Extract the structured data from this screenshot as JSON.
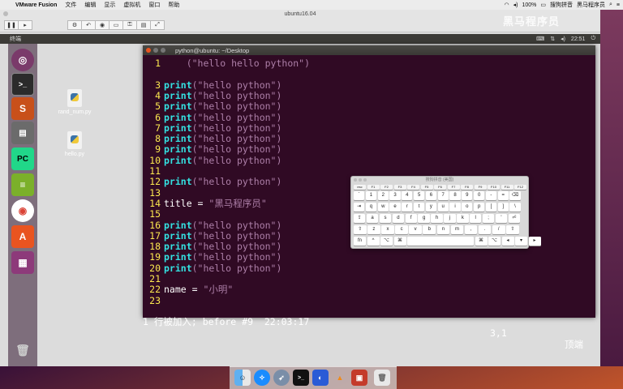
{
  "macbar": {
    "app": "VMware Fusion",
    "menus": [
      "文件",
      "编辑",
      "显示",
      "虚拟机",
      "窗口",
      "帮助"
    ],
    "battery": "100%",
    "ime": "搜狗拼音",
    "watermark_menu": "黑马程序员"
  },
  "vm": {
    "title": "ubuntu16.04"
  },
  "ubuntu_panel": {
    "app_name": "终端",
    "time": "22:51"
  },
  "desktop_icons": [
    {
      "label": "rand_num.py"
    },
    {
      "label": "hello.py"
    }
  ],
  "terminal": {
    "title": "python@ubuntu: ~/Desktop",
    "status": "1 行被加入; before #9  22:03:17",
    "cursor_pos": "3,1",
    "scroll_pos": "顶端",
    "lines": [
      {
        "num": "1",
        "kw": "",
        "str": "    (\"hello hello python\")",
        "plain": ""
      },
      {
        "num": "",
        "kw": "",
        "str": "",
        "plain": ""
      },
      {
        "num": "3",
        "kw": "print",
        "str": "(\"hello python\")",
        "plain": ""
      },
      {
        "num": "4",
        "kw": "print",
        "str": "(\"hello python\")",
        "plain": ""
      },
      {
        "num": "5",
        "kw": "print",
        "str": "(\"hello python\")",
        "plain": ""
      },
      {
        "num": "6",
        "kw": "print",
        "str": "(\"hello python\")",
        "plain": ""
      },
      {
        "num": "7",
        "kw": "print",
        "str": "(\"hello python\")",
        "plain": ""
      },
      {
        "num": "8",
        "kw": "print",
        "str": "(\"hello python\")",
        "plain": ""
      },
      {
        "num": "9",
        "kw": "print",
        "str": "(\"hello python\")",
        "plain": ""
      },
      {
        "num": "10",
        "kw": "print",
        "str": "(\"hello python\")",
        "plain": ""
      },
      {
        "num": "11",
        "kw": "",
        "str": "",
        "plain": ""
      },
      {
        "num": "12",
        "kw": "print",
        "str": "(\"hello python\")",
        "plain": ""
      },
      {
        "num": "13",
        "kw": "",
        "str": "",
        "plain": ""
      },
      {
        "num": "14",
        "kw": "",
        "str": "\"黑马程序员\"",
        "plain": "title = "
      },
      {
        "num": "15",
        "kw": "",
        "str": "",
        "plain": ""
      },
      {
        "num": "16",
        "kw": "print",
        "str": "(\"hello python\")",
        "plain": ""
      },
      {
        "num": "17",
        "kw": "print",
        "str": "(\"hello python\")",
        "plain": ""
      },
      {
        "num": "18",
        "kw": "print",
        "str": "(\"hello python\")",
        "plain": ""
      },
      {
        "num": "19",
        "kw": "print",
        "str": "(\"hello python\")",
        "plain": ""
      },
      {
        "num": "20",
        "kw": "print",
        "str": "(\"hello python\")",
        "plain": ""
      },
      {
        "num": "21",
        "kw": "",
        "str": "",
        "plain": ""
      },
      {
        "num": "22",
        "kw": "",
        "str": "\"小明\"",
        "plain": "name = "
      },
      {
        "num": "23",
        "kw": "",
        "str": "",
        "plain": ""
      }
    ]
  },
  "keyboard": {
    "title": "搜狗拼音 (美国)",
    "fn_row": [
      "esc",
      "F1",
      "F2",
      "F3",
      "F4",
      "F5",
      "F6",
      "F7",
      "F8",
      "F9",
      "F10",
      "F11",
      "F12"
    ],
    "row1": [
      "`",
      "1",
      "2",
      "3",
      "4",
      "5",
      "6",
      "7",
      "8",
      "9",
      "0",
      "-",
      "=",
      "⌫"
    ],
    "row2": [
      "⇥",
      "q",
      "w",
      "e",
      "r",
      "t",
      "y",
      "u",
      "i",
      "o",
      "p",
      "[",
      "]",
      "\\"
    ],
    "row3": [
      "⇪",
      "a",
      "s",
      "d",
      "f",
      "g",
      "h",
      "j",
      "k",
      "l",
      ";",
      "'",
      "⏎"
    ],
    "row4": [
      "⇧",
      "z",
      "x",
      "c",
      "v",
      "b",
      "n",
      "m",
      ",",
      ".",
      "/",
      "⇧"
    ],
    "row5": [
      "fn",
      "^",
      "⌥",
      "⌘",
      "",
      "⌘",
      "⌥",
      "◂",
      "▾",
      "▸"
    ]
  },
  "watermark": "黑马程序员"
}
